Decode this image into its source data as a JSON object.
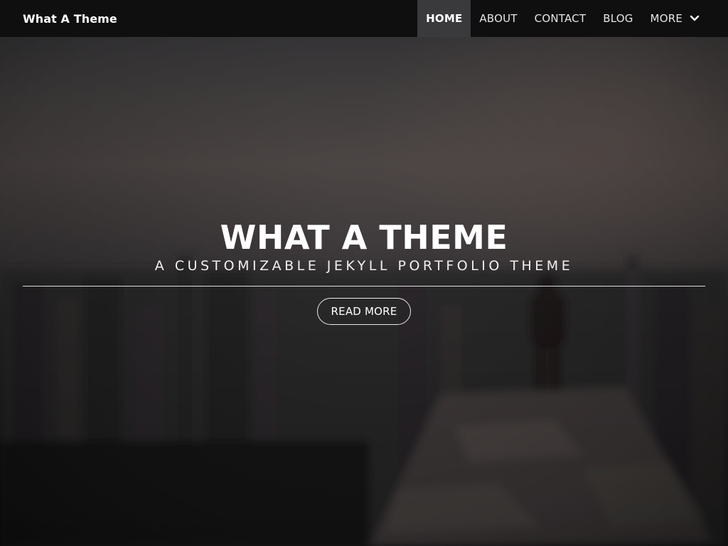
{
  "navbar": {
    "brand": "What A Theme",
    "links": [
      {
        "label": "HOME",
        "active": true
      },
      {
        "label": "ABOUT",
        "active": false
      },
      {
        "label": "CONTACT",
        "active": false
      },
      {
        "label": "BLOG",
        "active": false
      },
      {
        "label": "MORE",
        "active": false,
        "icon": "chevron-down-icon"
      }
    ]
  },
  "hero": {
    "title": "WHAT A THEME",
    "subtitle": "A CUSTOMIZABLE JEKYLL PORTFOLIO THEME",
    "button_label": "READ MORE"
  },
  "colors": {
    "navbar_bg": "#0f0f10",
    "active_nav_bg": "#3a3a3c",
    "text": "#ffffff"
  }
}
